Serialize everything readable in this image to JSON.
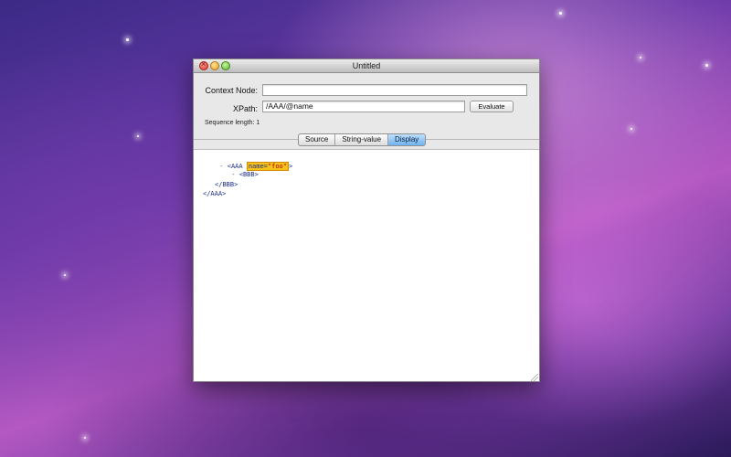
{
  "window": {
    "title": "Untitled"
  },
  "form": {
    "context_label": "Context Node:",
    "context_value": "",
    "xpath_label": "XPath:",
    "xpath_value": "/AAA/@name",
    "evaluate_label": "Evaluate"
  },
  "status": {
    "sequence_length": "Sequence length: 1"
  },
  "tabs": [
    {
      "label": "Source",
      "selected": false
    },
    {
      "label": "String-value",
      "selected": false
    },
    {
      "label": "Display",
      "selected": true
    }
  ],
  "tree": {
    "toggle": "-",
    "aaa_open": "<AAA",
    "attr_name": "name=",
    "attr_value": "\"foo\"",
    "aaa_gt": ">",
    "bbb_open": "<BBB>",
    "bbb_close": "</BBB>",
    "aaa_close": "</AAA>"
  },
  "colors": {
    "highlight": "#f6c21a",
    "selected_tab": "#6fb2ee"
  }
}
